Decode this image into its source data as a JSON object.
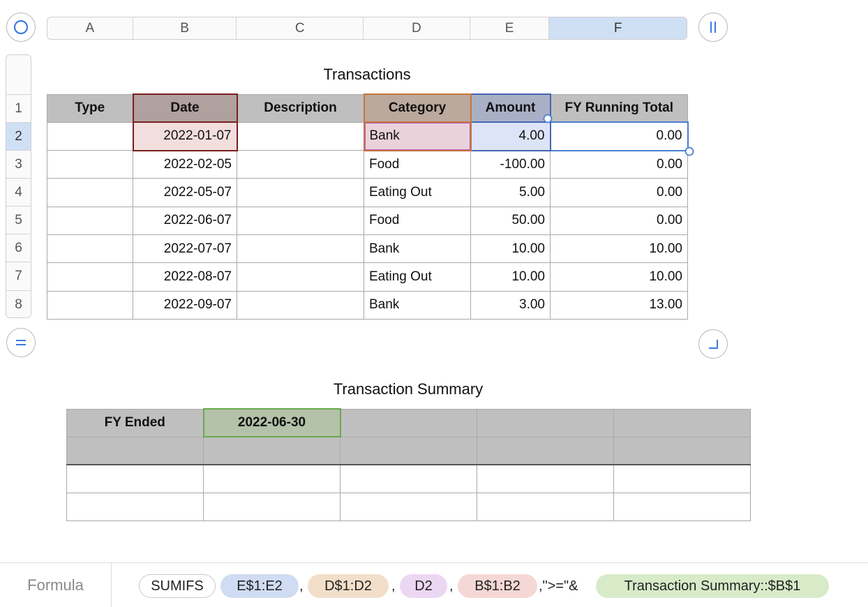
{
  "columns": [
    "A",
    "B",
    "C",
    "D",
    "E",
    "F"
  ],
  "rows": [
    "1",
    "2",
    "3",
    "4",
    "5",
    "6",
    "7",
    "8"
  ],
  "selection": {
    "column": "F",
    "row": "2"
  },
  "transactions": {
    "title": "Transactions",
    "headers": [
      "Type",
      "Date",
      "Description",
      "Category",
      "Amount",
      "FY Running Total"
    ],
    "rows": [
      [
        "",
        "2022-01-07",
        "",
        "Bank",
        "4.00",
        "0.00"
      ],
      [
        "",
        "2022-02-05",
        "",
        "Food",
        "-100.00",
        "0.00"
      ],
      [
        "",
        "2022-05-07",
        "",
        "Eating Out",
        "5.00",
        "0.00"
      ],
      [
        "",
        "2022-06-07",
        "",
        "Food",
        "50.00",
        "0.00"
      ],
      [
        "",
        "2022-07-07",
        "",
        "Bank",
        "10.00",
        "10.00"
      ],
      [
        "",
        "2022-08-07",
        "",
        "Eating Out",
        "10.00",
        "10.00"
      ],
      [
        "",
        "2022-09-07",
        "",
        "Bank",
        "3.00",
        "13.00"
      ]
    ]
  },
  "summary": {
    "title": "Transaction Summary",
    "label": "FY Ended",
    "value": "2022-06-30"
  },
  "formula": {
    "label": "Formula",
    "function": "SUMIFS",
    "tokens": [
      "E$1:E2",
      "D$1:D2",
      "D2",
      "B$1:B2"
    ],
    "separator": ",",
    "operator": ",\">=\"&",
    "reference": "Transaction Summary::$B$1"
  },
  "colors": {
    "accent_blue": "#4a7fd4",
    "header_gray": "#bfbfbf",
    "date_ref": "#7a1f1f",
    "category_ref": "#c8763a",
    "amount_ref": "#4466b5",
    "summary_ref": "#6aa84f"
  }
}
